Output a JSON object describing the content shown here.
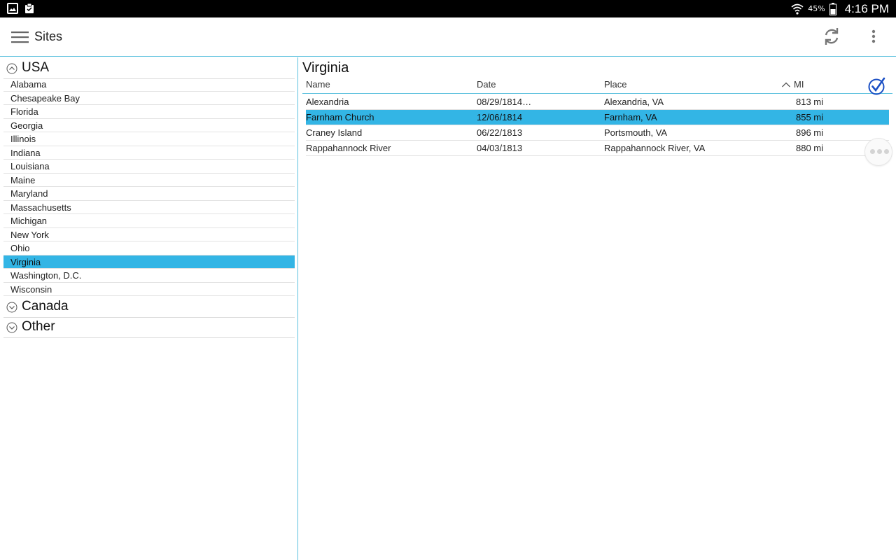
{
  "status_bar": {
    "battery_percent": "45%",
    "time": "4:16 PM"
  },
  "app_bar": {
    "title": "Sites",
    "menu_icon": "hamburger-menu-icon",
    "refresh_icon": "refresh-icon",
    "overflow_icon": "more-vert-icon"
  },
  "sidebar": {
    "groups": [
      {
        "label": "USA",
        "expanded": true,
        "items": [
          {
            "label": "Alabama"
          },
          {
            "label": "Chesapeake Bay"
          },
          {
            "label": "Florida"
          },
          {
            "label": "Georgia"
          },
          {
            "label": "Illinois"
          },
          {
            "label": "Indiana"
          },
          {
            "label": "Louisiana"
          },
          {
            "label": "Maine"
          },
          {
            "label": "Maryland"
          },
          {
            "label": "Massachusetts"
          },
          {
            "label": "Michigan"
          },
          {
            "label": "New York"
          },
          {
            "label": "Ohio"
          },
          {
            "label": "Virginia",
            "selected": true
          },
          {
            "label": "Washington, D.C."
          },
          {
            "label": "Wisconsin"
          }
        ]
      },
      {
        "label": "Canada",
        "expanded": false
      },
      {
        "label": "Other",
        "expanded": false
      }
    ]
  },
  "main": {
    "region_title": "Virginia",
    "columns": {
      "name": "Name",
      "date": "Date",
      "place": "Place",
      "mi": "MI"
    },
    "rows": [
      {
        "name": "Alexandria",
        "date": "08/29/1814…",
        "place": "Alexandria, VA",
        "mi": "813 mi"
      },
      {
        "name": "Farnham Church",
        "date": "12/06/1814",
        "place": "Farnham, VA",
        "mi": "855 mi",
        "selected": true
      },
      {
        "name": "Craney Island",
        "date": "06/22/1813",
        "place": "Portsmouth, VA",
        "mi": "896 mi"
      },
      {
        "name": "Rappahannock River",
        "date": "04/03/1813",
        "place": "Rappahannock River, VA",
        "mi": "880 mi"
      }
    ]
  },
  "colors": {
    "accent": "#33b5e5",
    "divider": "#5bc0de",
    "check": "#1a4fc4"
  }
}
